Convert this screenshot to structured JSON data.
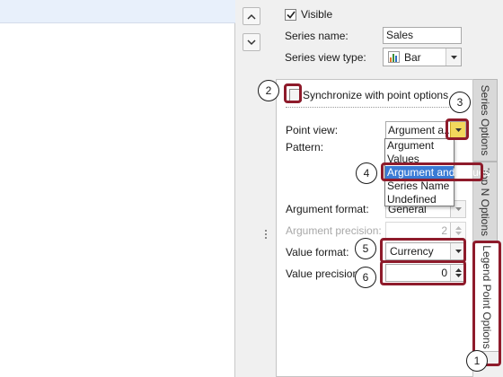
{
  "top": {
    "visible_label": "Visible",
    "series_name_label": "Series name:",
    "series_name_value": "Sales",
    "series_view_type_label": "Series view type:",
    "series_view_type_value": "Bar"
  },
  "point_options": {
    "sync_label": "Synchronize with point options",
    "point_view_label": "Point view:",
    "point_view_value": "Argument a...",
    "pattern_label": "Pattern:",
    "dropdown_items": [
      "Argument",
      "Values",
      "Argument and Values",
      "Series Name",
      "Undefined"
    ],
    "argument_format_label": "Argument format:",
    "argument_format_value": "General",
    "argument_precision_label": "Argument precision:",
    "argument_precision_value": "2",
    "value_format_label": "Value format:",
    "value_format_value": "Currency",
    "value_precision_label": "Value precision:",
    "value_precision_value": "0"
  },
  "tabs": [
    "Series Options",
    "Top N Options",
    "Legend Point Options"
  ],
  "callouts": [
    "1",
    "2",
    "3",
    "4",
    "5",
    "6"
  ],
  "icons": {
    "up": "chevron-up-icon",
    "down": "chevron-down-icon",
    "check": "check-icon",
    "bar_chart": "bar-chart-icon"
  },
  "colors": {
    "highlight_border": "#8e1b2b",
    "selection": "#3a7bd5",
    "combo_button_highlight": "#f2d75c"
  }
}
